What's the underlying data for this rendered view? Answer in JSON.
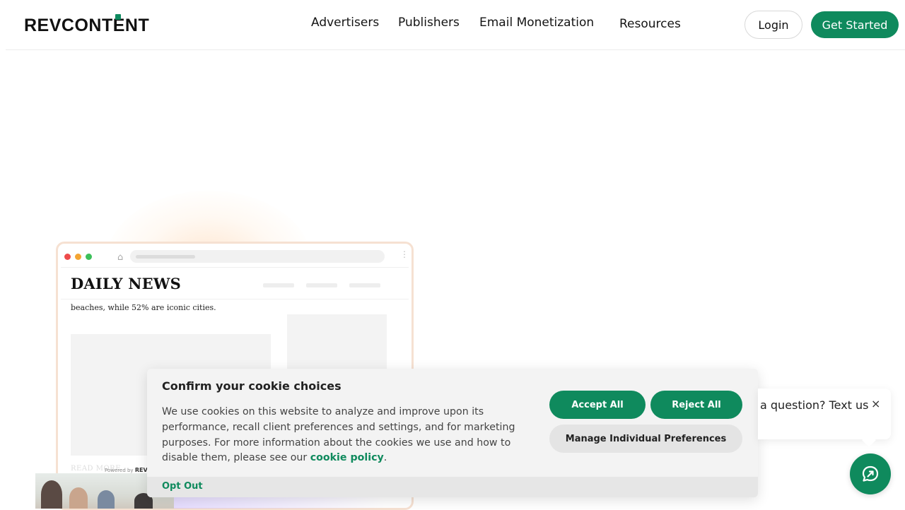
{
  "header": {
    "logo_text": "REVCONTENT",
    "nav": [
      {
        "label": "Advertisers"
      },
      {
        "label": "Publishers"
      },
      {
        "label": "Email Monetization"
      },
      {
        "label": "Resources"
      }
    ],
    "login_label": "Login",
    "get_started_label": "Get Started"
  },
  "hero_mock": {
    "brand": "DAILY NEWS",
    "caption": "beaches, while 52% are iconic cities.",
    "read_more": "READ MORE",
    "powered_by": "Powered by",
    "powered_brand": "REVC"
  },
  "cookie": {
    "title": "Confirm your cookie choices",
    "body": "We use cookies on this website to analyze and improve upon its performance, recall client preferences and settings, and for marketing purposes. For more information about the cookies we use and how to disable them, please see our ",
    "policy_link": "cookie policy",
    "body_end": ".",
    "accept_label": "Accept All",
    "reject_label": "Reject All",
    "manage_label": "Manage Individual Preferences",
    "optout_label": "Opt Out"
  },
  "chat": {
    "text": "a question? Text us",
    "close": "×"
  },
  "colors": {
    "brand_green": "#0f8a5d",
    "banner_bg": "#f3f3f3"
  }
}
